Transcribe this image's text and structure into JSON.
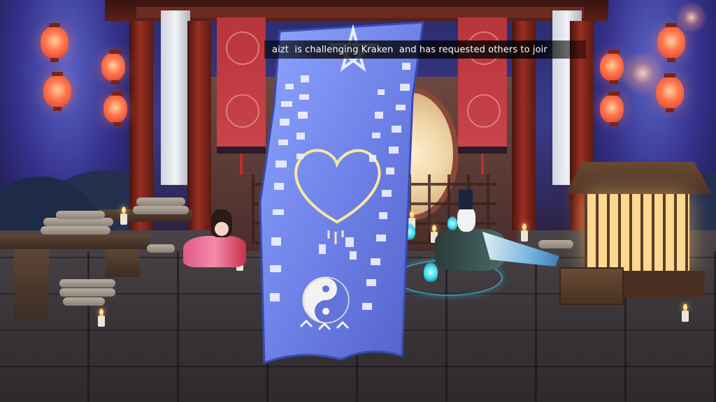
{
  "notification": {
    "text": "aizt  is challenging Kraken  and has requested others to joir"
  },
  "scene": {
    "name": "pavilion-night-scene",
    "banner_icons": [
      "pentagram-icon",
      "heart-icon",
      "yin-yang-icon"
    ]
  },
  "colors": {
    "banner": "#6f82e8",
    "lantern": "#e8402e",
    "pillar": "#8a2a1f",
    "spirit_glow": "#30d8f0"
  }
}
